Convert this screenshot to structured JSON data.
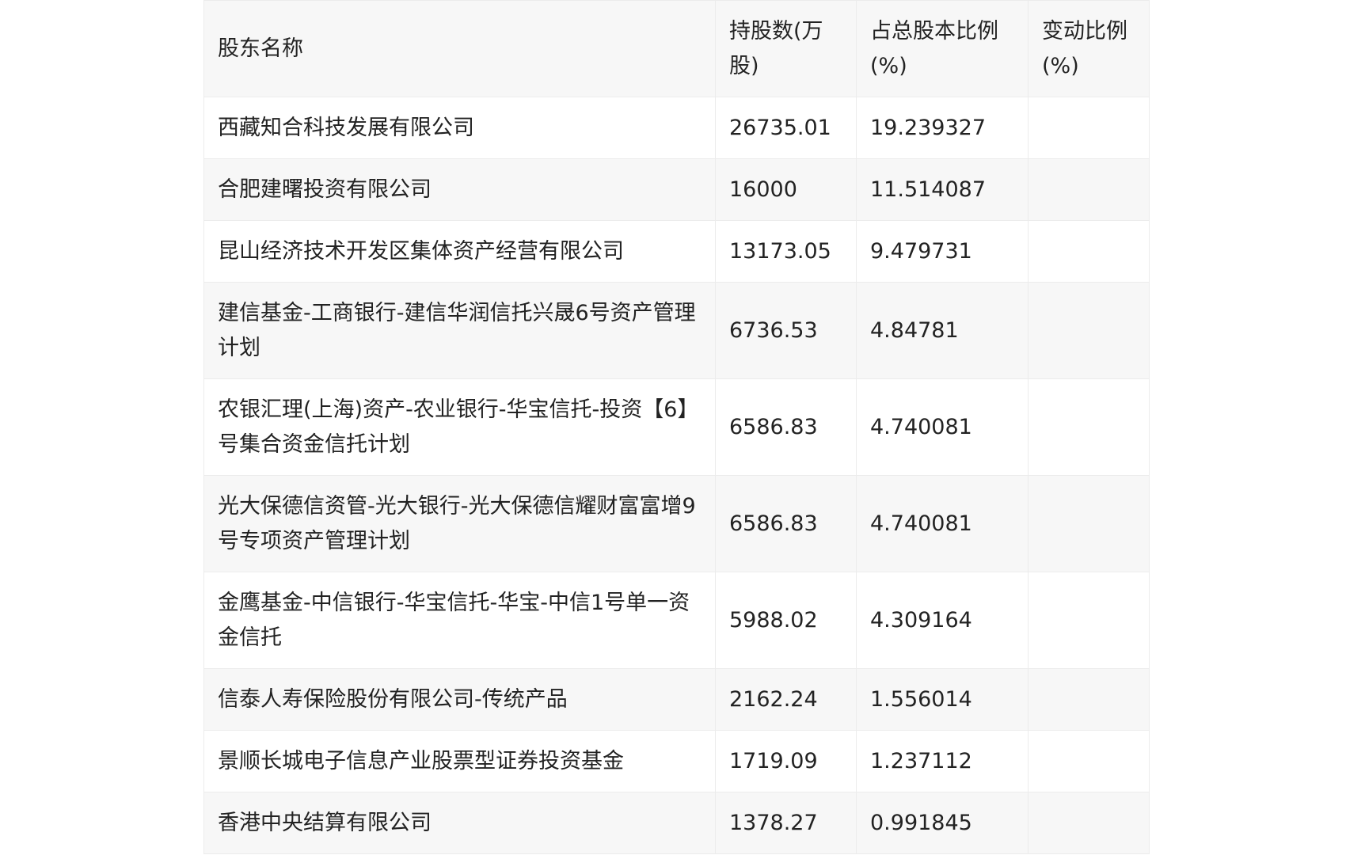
{
  "table": {
    "headers": {
      "name": "股东名称",
      "shares": "持股数(万股)",
      "ratio": "占总股本比例(%)",
      "change": "变动比例(%)"
    },
    "rows": [
      {
        "name": "西藏知合科技发展有限公司",
        "shares": "26735.01",
        "ratio": "19.239327",
        "change": ""
      },
      {
        "name": "合肥建曙投资有限公司",
        "shares": "16000",
        "ratio": "11.514087",
        "change": ""
      },
      {
        "name": "昆山经济技术开发区集体资产经营有限公司",
        "shares": "13173.05",
        "ratio": "9.479731",
        "change": ""
      },
      {
        "name": "建信基金-工商银行-建信华润信托兴晟6号资产管理计划",
        "shares": "6736.53",
        "ratio": "4.84781",
        "change": ""
      },
      {
        "name": "农银汇理(上海)资产-农业银行-华宝信托-投资【6】号集合资金信托计划",
        "shares": "6586.83",
        "ratio": "4.740081",
        "change": ""
      },
      {
        "name": "光大保德信资管-光大银行-光大保德信耀财富富增9号专项资产管理计划",
        "shares": "6586.83",
        "ratio": "4.740081",
        "change": ""
      },
      {
        "name": "金鹰基金-中信银行-华宝信托-华宝-中信1号单一资金信托",
        "shares": "5988.02",
        "ratio": "4.309164",
        "change": ""
      },
      {
        "name": "信泰人寿保险股份有限公司-传统产品",
        "shares": "2162.24",
        "ratio": "1.556014",
        "change": ""
      },
      {
        "name": "景顺长城电子信息产业股票型证券投资基金",
        "shares": "1719.09",
        "ratio": "1.237112",
        "change": ""
      },
      {
        "name": "香港中央结算有限公司",
        "shares": "1378.27",
        "ratio": "0.991845",
        "change": ""
      }
    ]
  }
}
